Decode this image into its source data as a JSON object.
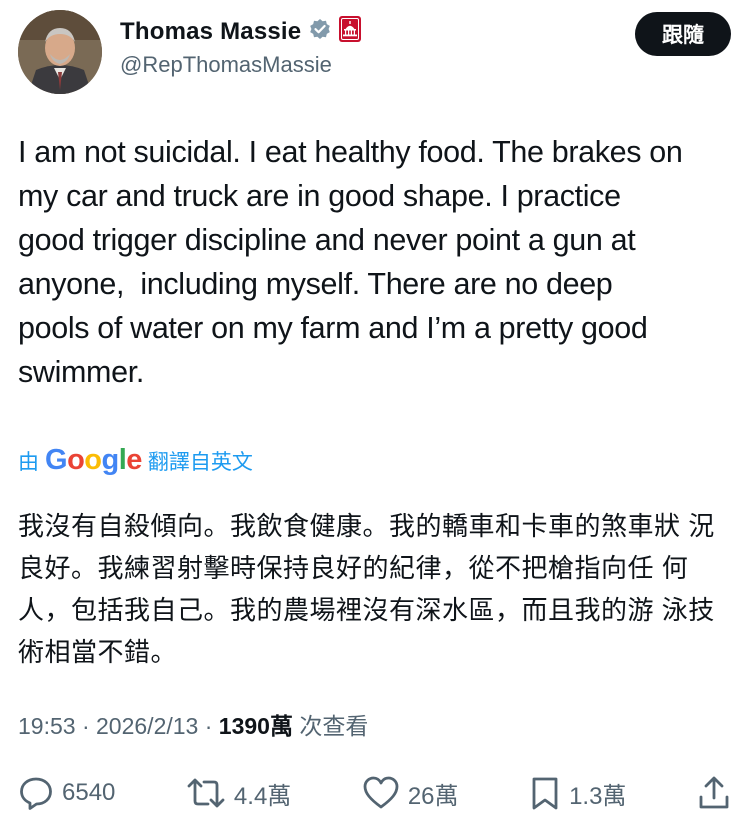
{
  "author": {
    "display_name": "Thomas Massie",
    "handle": "@RepThomasMassie",
    "verified_icon": "verified-badge-icon",
    "affiliation_icon": "capitol-icon"
  },
  "follow_label": "跟隨",
  "tweet": {
    "text": "I am not suicidal. I eat healthy food. The brakes on\nmy car and truck are in good shape. I practice\ngood trigger discipline and never point a gun at\nanyone,  including myself. There are no deep\npools of water on my farm and I’m a pretty good\nswimmer."
  },
  "translation": {
    "by": "由",
    "provider": "Google",
    "from": "翻譯自英文",
    "text": "我沒有自殺傾向。我飲食健康。我的轎車和卡車的煞車狀\n況良好。我練習射擊時保持良好的紀律，從不把槍指向任\n何人，包括我自己。我的農場裡沒有深水區，而且我的游\n泳技術相當不錯。"
  },
  "meta": {
    "time": "19:53",
    "sep1": " · ",
    "date": "2026/2/13",
    "sep2": " · ",
    "views": "1390萬",
    "views_label": " 次查看"
  },
  "actions": {
    "replies": "6540",
    "reposts": "4.4萬",
    "likes": "26萬",
    "bookmarks": "1.3萬"
  },
  "colors": {
    "text": "#0f1419",
    "secondary": "#536471",
    "link": "#1d9bf0",
    "verified": "#829aab",
    "affiliation": "#c8102e"
  }
}
